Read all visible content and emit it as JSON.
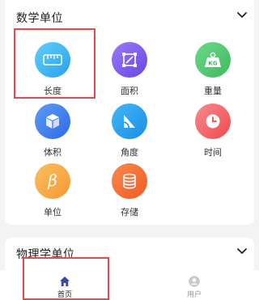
{
  "math_section": {
    "title": "数学单位",
    "items": [
      {
        "label": "长度",
        "icon": "ruler-icon",
        "color": "#2ea7f2"
      },
      {
        "label": "面积",
        "icon": "area-icon",
        "color": "#7c5cf0"
      },
      {
        "label": "重量",
        "icon": "weight-kg-icon",
        "color": "#4cc46a"
      },
      {
        "label": "体积",
        "icon": "cube-icon",
        "color": "#3b7cf0"
      },
      {
        "label": "角度",
        "icon": "angle-icon",
        "color": "#1f9ff0"
      },
      {
        "label": "时间",
        "icon": "clock-icon",
        "color": "#f0595c"
      },
      {
        "label": "单位",
        "icon": "beta-icon",
        "color": "#f7a544"
      },
      {
        "label": "存储",
        "icon": "database-icon",
        "color": "#f76a2e"
      }
    ]
  },
  "physics_section": {
    "title": "物理学单位"
  },
  "tabbar": {
    "home": {
      "label": "首页",
      "color": "#222222",
      "icon": "home-icon"
    },
    "user": {
      "label": "用户",
      "color": "#999999",
      "icon": "user-icon"
    }
  },
  "colors": {
    "highlight": "#e5484d",
    "background": "#f2f3f5"
  }
}
